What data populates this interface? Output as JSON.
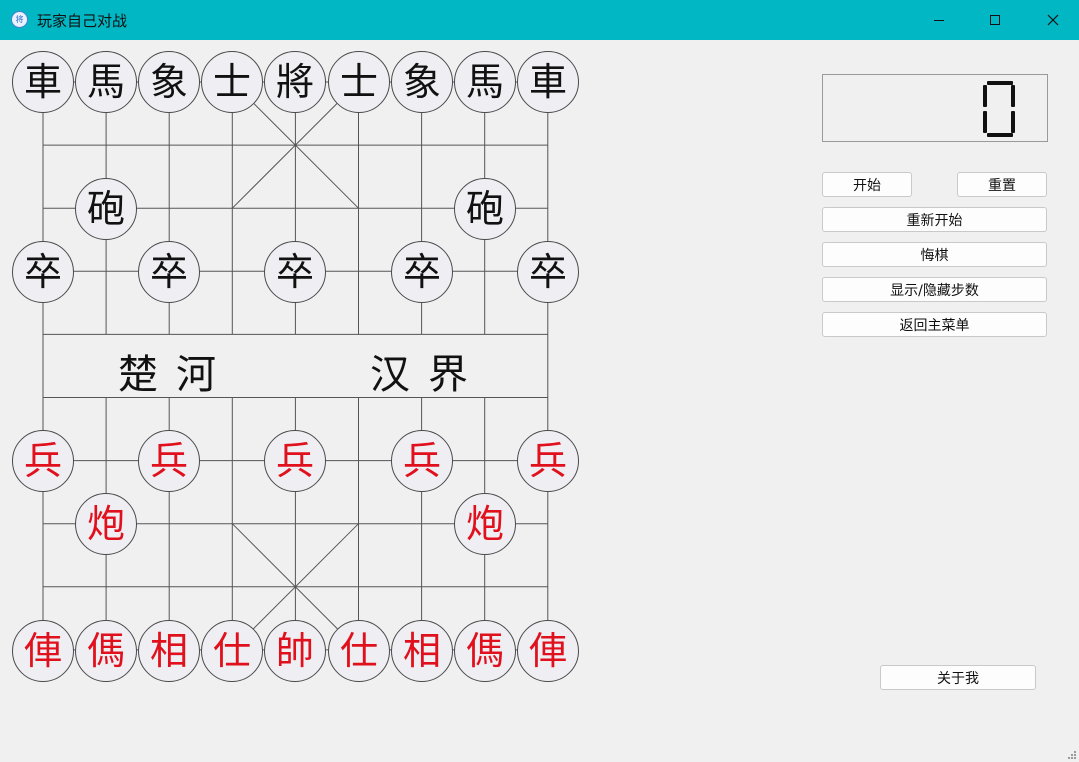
{
  "window": {
    "title": "玩家自己对战",
    "icon_name": "app-chess-icon",
    "icon_glyph": "将"
  },
  "controls": {
    "minimize": "minimize-icon",
    "maximize": "maximize-icon",
    "close": "close-icon"
  },
  "board": {
    "river_left": "楚河",
    "river_right": "汉界",
    "black_back_row": [
      "車",
      "馬",
      "象",
      "士",
      "將",
      "士",
      "象",
      "馬",
      "車"
    ],
    "black_cannons": [
      "砲",
      "砲"
    ],
    "black_soldiers": [
      "卒",
      "卒",
      "卒",
      "卒",
      "卒"
    ],
    "red_soldiers": [
      "兵",
      "兵",
      "兵",
      "兵",
      "兵"
    ],
    "red_cannons": [
      "炮",
      "炮"
    ],
    "red_back_row": [
      "俥",
      "傌",
      "相",
      "仕",
      "帥",
      "仕",
      "相",
      "傌",
      "俥"
    ],
    "colors": {
      "red": "#e0101c",
      "black": "#111111",
      "piece_fill": "#eeeef3"
    }
  },
  "step_counter": {
    "value": "0"
  },
  "buttons": {
    "start": "开始",
    "reset": "重置",
    "restart": "重新开始",
    "undo": "悔棋",
    "toggle_steps": "显示/隐藏步数",
    "back_to_menu": "返回主菜单",
    "about": "关于我"
  },
  "accent": "#00b7c3"
}
